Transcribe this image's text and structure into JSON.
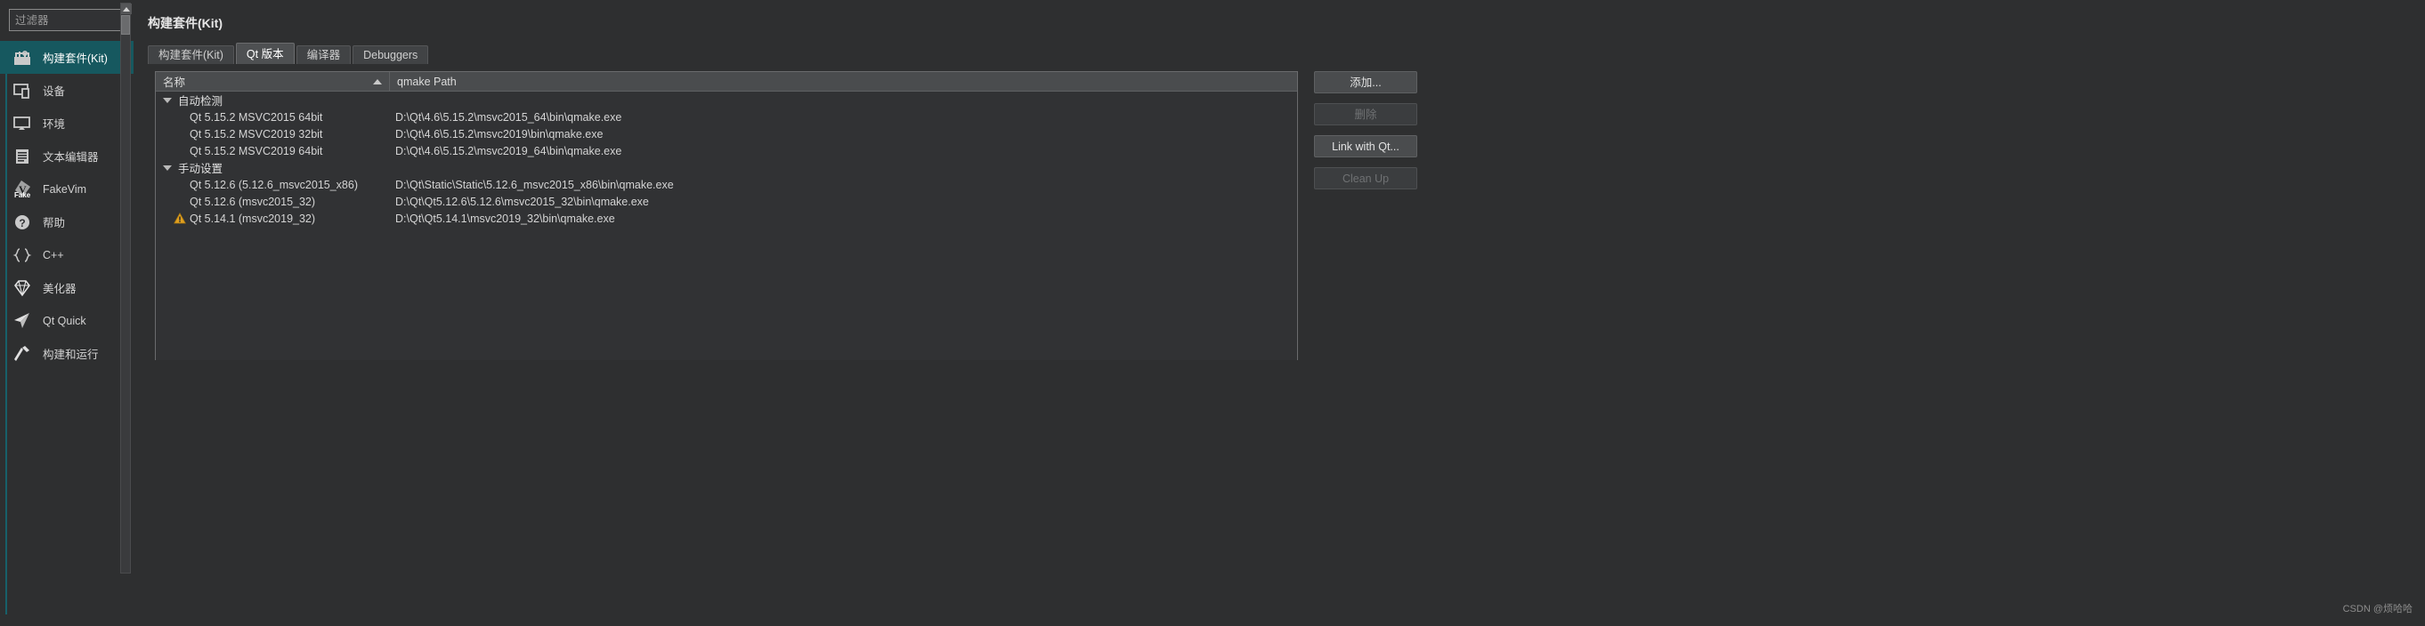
{
  "sidebar": {
    "filter": {
      "value": "",
      "placeholder": "过滤器"
    },
    "items": [
      {
        "label": "构建套件(Kit)",
        "icon": "kit-icon",
        "selected": true
      },
      {
        "label": "设备",
        "icon": "device-icon",
        "selected": false
      },
      {
        "label": "环境",
        "icon": "monitor-icon",
        "selected": false
      },
      {
        "label": "文本编辑器",
        "icon": "text-editor-icon",
        "selected": false
      },
      {
        "label": "FakeVim",
        "icon": "fakevim-icon",
        "selected": false
      },
      {
        "label": "帮助",
        "icon": "help-icon",
        "selected": false
      },
      {
        "label": "C++",
        "icon": "braces-icon",
        "selected": false
      },
      {
        "label": "美化器",
        "icon": "diamond-icon",
        "selected": false
      },
      {
        "label": "Qt Quick",
        "icon": "paper-plane-icon",
        "selected": false
      },
      {
        "label": "构建和运行",
        "icon": "hammer-icon",
        "selected": false
      }
    ]
  },
  "header": {
    "title": "构建套件(Kit)"
  },
  "tabs": [
    {
      "label": "构建套件(Kit)",
      "active": false
    },
    {
      "label": "Qt 版本",
      "active": true
    },
    {
      "label": "编译器",
      "active": false
    },
    {
      "label": "Debuggers",
      "active": false
    }
  ],
  "table": {
    "columns": [
      "名称",
      "qmake Path"
    ],
    "sort": {
      "column": "名称",
      "direction": "asc"
    },
    "groups": [
      {
        "label": "自动检测",
        "expanded": true,
        "rows": [
          {
            "name": "Qt 5.15.2 MSVC2015 64bit",
            "path": "D:\\Qt\\4.6\\5.15.2\\msvc2015_64\\bin\\qmake.exe",
            "warning": false
          },
          {
            "name": "Qt 5.15.2 MSVC2019 32bit",
            "path": "D:\\Qt\\4.6\\5.15.2\\msvc2019\\bin\\qmake.exe",
            "warning": false
          },
          {
            "name": "Qt 5.15.2 MSVC2019 64bit",
            "path": "D:\\Qt\\4.6\\5.15.2\\msvc2019_64\\bin\\qmake.exe",
            "warning": false
          }
        ]
      },
      {
        "label": "手动设置",
        "expanded": true,
        "rows": [
          {
            "name": "Qt 5.12.6 (5.12.6_msvc2015_x86)",
            "path": "D:\\Qt\\Static\\Static\\5.12.6_msvc2015_x86\\bin\\qmake.exe",
            "warning": false
          },
          {
            "name": "Qt 5.12.6 (msvc2015_32)",
            "path": "D:\\Qt\\Qt5.12.6\\5.12.6\\msvc2015_32\\bin\\qmake.exe",
            "warning": false
          },
          {
            "name": "Qt 5.14.1 (msvc2019_32)",
            "path": "D:\\Qt\\Qt5.14.1\\msvc2019_32\\bin\\qmake.exe",
            "warning": true
          }
        ]
      }
    ]
  },
  "buttons": [
    {
      "label": "添加...",
      "enabled": true
    },
    {
      "label": "删除",
      "enabled": false
    },
    {
      "label": "Link with Qt...",
      "enabled": true
    },
    {
      "label": "Clean Up",
      "enabled": false
    }
  ],
  "watermark": "CSDN @烦哈哈",
  "colors": {
    "accent": "#16585f",
    "background": "#2e2f30",
    "panel": "#313234",
    "warning": "#e0a020"
  }
}
